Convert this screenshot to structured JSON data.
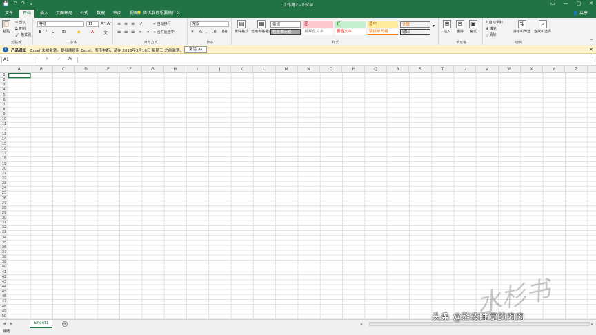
{
  "window": {
    "title": "工作簿2 - Excel",
    "qat": [
      "💾",
      "↶",
      "↷",
      "⌄"
    ],
    "controls": [
      "▭",
      "—",
      "▢",
      "✕"
    ]
  },
  "tabs": [
    "文件",
    "开始",
    "插入",
    "页面布局",
    "公式",
    "数据",
    "审阅",
    "视图"
  ],
  "active_tab": "开始",
  "tell_me": "告诉我你想要做什么",
  "account": "共享",
  "ribbon": {
    "clipboard": {
      "label": "剪贴板",
      "paste": "粘贴",
      "cut": "剪切",
      "copy": "复制",
      "painter": "格式刷"
    },
    "font": {
      "label": "字体",
      "name": "等线",
      "size": "11"
    },
    "alignment": {
      "label": "对齐方式",
      "wrap": "自动换行",
      "merge": "合并后居中"
    },
    "number": {
      "label": "数字",
      "format": "常规"
    },
    "styles": {
      "label": "样式",
      "conditional": "条件格式",
      "table": "套用表格格式",
      "cells": [
        {
          "text": "常规",
          "bg": "#ffffff",
          "fg": "#222222"
        },
        {
          "text": "差",
          "bg": "#ffc7ce",
          "fg": "#9c0006"
        },
        {
          "text": "好",
          "bg": "#c6efce",
          "fg": "#006100"
        },
        {
          "text": "适中",
          "bg": "#ffeb9c",
          "fg": "#9c5700"
        },
        {
          "text": "计算",
          "bg": "#f2f2f2",
          "fg": "#fa7d00"
        },
        {
          "text": "检查单元格",
          "bg": "#a5a5a5",
          "fg": "#ffffff"
        },
        {
          "text": "解释性文本",
          "bg": "#ffffff",
          "fg": "#7f7f7f"
        },
        {
          "text": "警告文本",
          "bg": "#ffffff",
          "fg": "#ff0000"
        },
        {
          "text": "链接单元格",
          "bg": "#ffffff",
          "fg": "#fa7d00"
        },
        {
          "text": "输出",
          "bg": "#f2f2f2",
          "fg": "#3f3f3f"
        }
      ]
    },
    "cells": {
      "label": "单元格",
      "insert": "插入",
      "delete": "删除",
      "format": "格式"
    },
    "editing": {
      "label": "编辑",
      "autosum": "自动求和",
      "fill": "填充",
      "clear": "清除",
      "sort": "排序和筛选",
      "find": "查找和选择"
    }
  },
  "notification": {
    "title": "产品通知",
    "message": "Excel 未被激活。要继续使用 Excel，而不中断，请在 2016年3月16日 星期三 之前激活。",
    "button": "激活(A)"
  },
  "formula_bar": {
    "name_box": "A1",
    "cancel": "✕",
    "confirm": "✓",
    "fx": "fx",
    "value": ""
  },
  "columns": [
    "A",
    "B",
    "C",
    "D",
    "E",
    "F",
    "G",
    "H",
    "I",
    "J",
    "K",
    "L",
    "M",
    "N",
    "O",
    "P",
    "Q",
    "R",
    "S",
    "T",
    "U",
    "V",
    "W",
    "X",
    "Y",
    "Z"
  ],
  "rows": [
    "1",
    "2",
    "3",
    "4",
    "5",
    "6",
    "7",
    "8",
    "9",
    "10",
    "11",
    "12",
    "13",
    "14",
    "15",
    "16",
    "17",
    "18",
    "19",
    "20",
    "21",
    "22",
    "23",
    "24",
    "25",
    "26",
    "27",
    "28",
    "29",
    "30",
    "31",
    "32",
    "33",
    "34",
    "35",
    "36",
    "37",
    "38",
    "39",
    "40",
    "41",
    "42",
    "43",
    "44",
    "45",
    "46",
    "47",
    "48",
    "49",
    "50"
  ],
  "sheet_tab": "Sheet1",
  "status": "就绪",
  "watermark": "头条 @熬夜睡觉的肉肉",
  "colors": {
    "accent": "#217346",
    "notify_bg": "#fff3cc"
  }
}
